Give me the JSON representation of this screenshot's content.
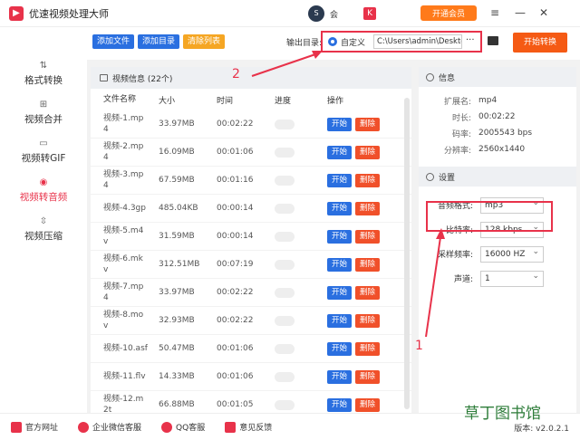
{
  "app": {
    "title": "优速视频处理大师",
    "logo_glyph": "▶",
    "user_name": "会",
    "avatar_glyph": "S",
    "badge": "K",
    "vip_label": "开通会员"
  },
  "window": {
    "menu_glyph": "≡",
    "min_glyph": "—",
    "close_glyph": "✕"
  },
  "toolbar": {
    "add_file": "添加文件",
    "add_dir": "添加目录",
    "clear_list": "清除列表",
    "output_label": "输出目录:",
    "custom_label": "自定义",
    "path": "C:\\Users\\admin\\Deskto",
    "more": "···",
    "start": "开始转换"
  },
  "sidebar": {
    "items": [
      {
        "label": "格式转换",
        "icon": "⇅"
      },
      {
        "label": "视频合并",
        "icon": "⊞"
      },
      {
        "label": "视频转GIF",
        "icon": "▭"
      },
      {
        "label": "视频转音频",
        "icon": "◉"
      },
      {
        "label": "视频压缩",
        "icon": "⇳"
      }
    ]
  },
  "filelist": {
    "header": "视频信息  (22个)",
    "columns": [
      "文件名称",
      "大小",
      "时间",
      "进度",
      "操作"
    ],
    "start_label": "开始",
    "delete_label": "删除",
    "rows": [
      {
        "name": "视频-1.mp4",
        "size": "33.97MB",
        "time": "00:02:22"
      },
      {
        "name": "视频-2.mp4",
        "size": "16.09MB",
        "time": "00:01:06"
      },
      {
        "name": "视频-3.mp4",
        "size": "67.59MB",
        "time": "00:01:16"
      },
      {
        "name": "视频-4.3gp",
        "size": "485.04KB",
        "time": "00:00:14"
      },
      {
        "name": "视频-5.m4v",
        "size": "31.59MB",
        "time": "00:00:14"
      },
      {
        "name": "视频-6.mkv",
        "size": "312.51MB",
        "time": "00:07:19"
      },
      {
        "name": "视频-7.mp4",
        "size": "33.97MB",
        "time": "00:02:22"
      },
      {
        "name": "视频-8.mov",
        "size": "32.93MB",
        "time": "00:02:22"
      },
      {
        "name": "视频-10.asf",
        "size": "50.47MB",
        "time": "00:01:06"
      },
      {
        "name": "视频-11.flv",
        "size": "14.33MB",
        "time": "00:01:06"
      },
      {
        "name": "视频-12.m2t",
        "size": "66.88MB",
        "time": "00:01:05"
      }
    ]
  },
  "info": {
    "header": "信息",
    "rows": [
      {
        "label": "扩展名:",
        "value": "mp4"
      },
      {
        "label": "时长:",
        "value": "00:02:22"
      },
      {
        "label": "码率:",
        "value": "2005543 bps"
      },
      {
        "label": "分辨率:",
        "value": "2560x1440"
      }
    ]
  },
  "settings": {
    "header": "设置",
    "rows": [
      {
        "label": "音频格式:",
        "value": "mp3"
      },
      {
        "label": "比特率:",
        "value": "128 kbps"
      },
      {
        "label": "采样频率:",
        "value": "16000 HZ"
      },
      {
        "label": "声道:",
        "value": "1"
      }
    ]
  },
  "footer": {
    "site": "官方网址",
    "wechat": "企业微信客服",
    "qq": "QQ客服",
    "feedback": "意见反馈",
    "version": "版本: v2.0.2.1"
  },
  "annotations": {
    "a1": "1",
    "a2": "2"
  },
  "watermark": "草丁图书馆",
  "colors": {
    "accent_red": "#e8324a",
    "blue": "#2a6fe0",
    "orange": "#f55a14"
  }
}
